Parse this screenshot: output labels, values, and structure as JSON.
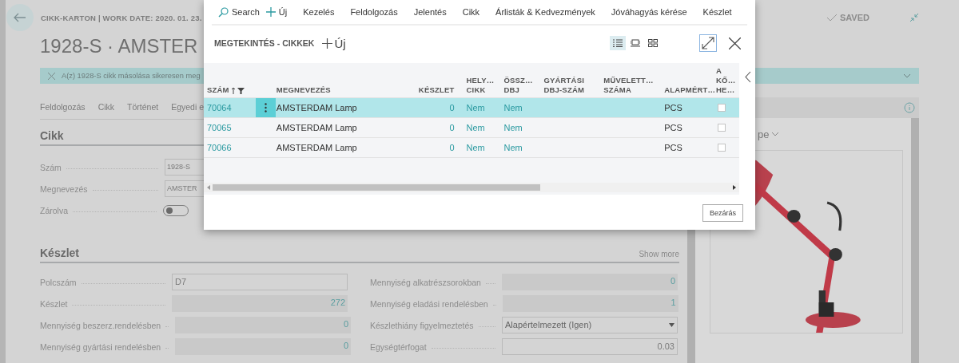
{
  "page": {
    "caption": "CIKK-KARTON | WORK DATE: 2020. 01. 23.",
    "title": "1928-S · AMSTER",
    "status": "SAVED"
  },
  "notification": "A(z) 1928-S cikk másolása sikeresen meg",
  "actions": [
    "Feldolgozás",
    "Cikk",
    "Történet",
    "Egyedi e"
  ],
  "general": {
    "title": "Cikk",
    "fields": [
      {
        "label": "Szám",
        "kind": "text",
        "value": "1928-S"
      },
      {
        "label": "Megnevezés",
        "kind": "text",
        "value": "AMSTER"
      },
      {
        "label": "Zárolva",
        "kind": "toggle",
        "on": false
      }
    ]
  },
  "inventory": {
    "title": "Készlet",
    "show_more": "Show more",
    "left": [
      {
        "label": "Polcszám",
        "kind": "text",
        "value": "D7"
      },
      {
        "label": "Készlet",
        "kind": "readonly",
        "value": "272"
      },
      {
        "label": "Mennyiség beszerz.rendelésben",
        "kind": "readonly",
        "value": "0"
      },
      {
        "label": "Mennyiség gyártási rendelésben",
        "kind": "readonly",
        "value": "0"
      }
    ],
    "right": [
      {
        "label": "Mennyiség alkatrészsorokban",
        "kind": "readonly",
        "value": "0"
      },
      {
        "label": "Mennyiség eladási rendelésben",
        "kind": "readonly",
        "value": "1"
      },
      {
        "label": "Készlethiány figyelmeztetés",
        "kind": "select",
        "value": "Alapértelmezett (Igen)"
      },
      {
        "label": "Egységtérfogat",
        "kind": "number",
        "value": "0.03"
      }
    ]
  },
  "factbox": {
    "title": "pe"
  },
  "modal": {
    "actions": [
      "Search",
      "Új",
      "Kezelés",
      "Feldolgozás",
      "Jelentés",
      "Cikk",
      "Árlisták & Kedvezmények",
      "Jóváhagyás kérése",
      "Készlet"
    ],
    "title": "MEGTEKINTÉS - CIKKEK",
    "new": "Új",
    "views": [
      {
        "kind": "list",
        "selected": true
      },
      {
        "kind": "tile",
        "selected": false
      },
      {
        "kind": "grid",
        "selected": false
      }
    ],
    "columns": [
      "SZÁM",
      "MEGNEVEZÉS",
      "KÉSZLET",
      "HELY…\nCIKK",
      "ÖSSZ…\nDBJ",
      "GYÁRTÁSI\nDBJ-SZÁM",
      "MŰVELETT…\nSZÁMA",
      "ALAPMÉRT…",
      "A\nKŐ…\nHE…"
    ],
    "rows": [
      {
        "selected": true,
        "number": "70064",
        "name": "AMSTERDAM Lamp",
        "stock": "0",
        "hely_cikk": "Nem",
        "ossz_dbj": "Nem",
        "unit": "PCS",
        "checked": false
      },
      {
        "selected": false,
        "number": "70065",
        "name": "AMSTERDAM Lamp",
        "stock": "0",
        "hely_cikk": "Nem",
        "ossz_dbj": "Nem",
        "unit": "PCS",
        "checked": false
      },
      {
        "selected": false,
        "number": "70066",
        "name": "AMSTERDAM Lamp",
        "stock": "0",
        "hely_cikk": "Nem",
        "ossz_dbj": "Nem",
        "unit": "PCS",
        "checked": false
      }
    ],
    "close": "Bezárás"
  }
}
